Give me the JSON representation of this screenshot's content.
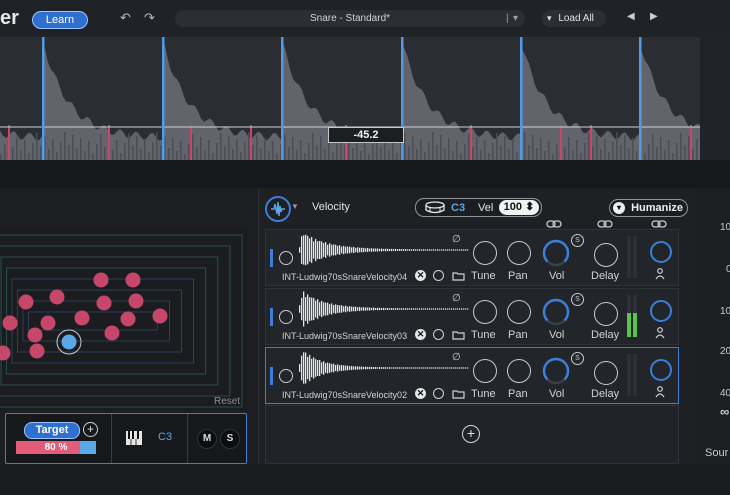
{
  "header": {
    "title_partial": "er",
    "learn_label": "Learn",
    "undo_glyph": "↶",
    "redo_glyph": "↷",
    "preset_name": "Snare - Standard*",
    "preset_separator": "|",
    "preset_dropdown_glyph": "▾",
    "load_all_label": "Load All",
    "load_all_glyph": "▾",
    "prev_glyph": "◀",
    "next_glyph": "▶"
  },
  "waveform": {
    "threshold_value": "-45.2"
  },
  "xy_pad": {
    "reset_label": "Reset"
  },
  "target": {
    "label": "Target",
    "plus_glyph": "+",
    "percent_text": "80 %",
    "percent_value": 80,
    "note": "C3",
    "mute_label": "M",
    "solo_label": "S"
  },
  "layers": {
    "mode_label": "Velocity",
    "note": "C3",
    "vel_label": "Vel",
    "vel_value": "100 ⬍",
    "humanize_label": "Humanize",
    "humanize_glyph": "▾",
    "add_glyph": "+",
    "rows": [
      {
        "name": "INT-Ludwig70sSnareVelocity04",
        "tune": "Tune",
        "pan": "Pan",
        "vol": "Vol",
        "delay": "Delay",
        "solo": "S",
        "phase": "∅"
      },
      {
        "name": "INT-Ludwig70sSnareVelocity03",
        "tune": "Tune",
        "pan": "Pan",
        "vol": "Vol",
        "delay": "Delay",
        "solo": "S",
        "phase": "∅"
      },
      {
        "name": "INT-Ludwig70sSnareVelocity02",
        "tune": "Tune",
        "pan": "Pan",
        "vol": "Vol",
        "delay": "Delay",
        "solo": "S",
        "phase": "∅"
      }
    ]
  },
  "right_panel": {
    "values": [
      "10",
      "0",
      "10",
      "20",
      "40"
    ],
    "infinity": "∞",
    "source_partial": "Sour"
  },
  "colors": {
    "accent": "#3b7fd8",
    "pink": "#c7476a",
    "meter_green": "#57c44a"
  }
}
